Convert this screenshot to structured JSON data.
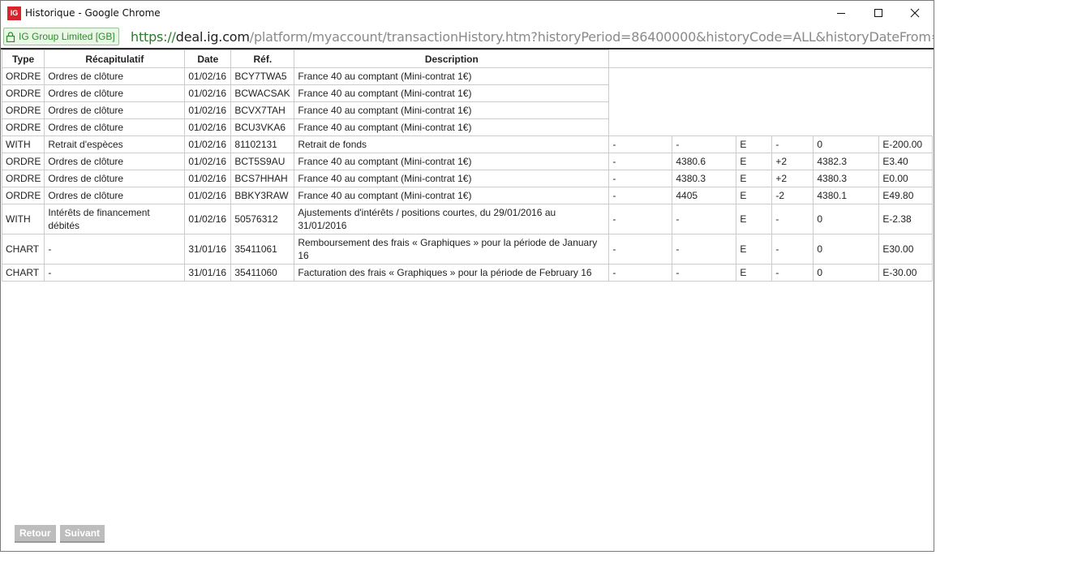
{
  "window": {
    "title": "Historique - Google Chrome",
    "app_icon_text": "IG",
    "controls": {
      "minimize": "—",
      "maximize": "☐",
      "close": "✕"
    }
  },
  "address": {
    "secure_label": "IG Group Limited [GB]",
    "url_scheme": "https://",
    "url_host": "deal.ig.com",
    "url_path": "/platform/myaccount/transactionHistory.htm?historyPeriod=86400000&historyCode=ALL&historyDateFrom=TODAY&hist"
  },
  "table": {
    "headers": [
      "Type",
      "Récapitulatif",
      "Date",
      "Réf.",
      "Description"
    ],
    "rows": [
      {
        "cells": [
          "ORDRE",
          "Ordres de clôture",
          "01/02/16",
          "BCY7TWA5",
          "France 40 au comptant (Mini-contrat 1€)"
        ],
        "extra": []
      },
      {
        "cells": [
          "ORDRE",
          "Ordres de clôture",
          "01/02/16",
          "BCWACSAK",
          "France 40 au comptant (Mini-contrat 1€)"
        ],
        "extra": []
      },
      {
        "cells": [
          "ORDRE",
          "Ordres de clôture",
          "01/02/16",
          "BCVX7TAH",
          "France 40 au comptant (Mini-contrat 1€)"
        ],
        "extra": []
      },
      {
        "cells": [
          "ORDRE",
          "Ordres de clôture",
          "01/02/16",
          "BCU3VKA6",
          "France 40 au comptant (Mini-contrat 1€)"
        ],
        "extra": []
      },
      {
        "cells": [
          "WITH",
          "Retrait d'espèces",
          "01/02/16",
          "81102131",
          "Retrait de fonds"
        ],
        "extra": [
          "-",
          "-",
          "E",
          "-",
          "0",
          "E-200.00"
        ]
      },
      {
        "cells": [
          "ORDRE",
          "Ordres de clôture",
          "01/02/16",
          "BCT5S9AU",
          "France 40 au comptant (Mini-contrat 1€)"
        ],
        "extra": [
          "-",
          "4380.6",
          "E",
          "+2",
          "4382.3",
          "E3.40"
        ]
      },
      {
        "cells": [
          "ORDRE",
          "Ordres de clôture",
          "01/02/16",
          "BCS7HHAH",
          "France 40 au comptant (Mini-contrat 1€)"
        ],
        "extra": [
          "-",
          "4380.3",
          "E",
          "+2",
          "4380.3",
          "E0.00"
        ]
      },
      {
        "cells": [
          "ORDRE",
          "Ordres de clôture",
          "01/02/16",
          "BBKY3RAW",
          "France 40 au comptant (Mini-contrat 1€)"
        ],
        "extra": [
          "-",
          "4405",
          "E",
          "-2",
          "4380.1",
          "E49.80"
        ]
      },
      {
        "cells": [
          "WITH",
          "Intérêts de financement débités",
          "01/02/16",
          "50576312",
          "Ajustements d'intérêts / positions courtes, du 29/01/2016 au 31/01/2016"
        ],
        "extra": [
          "-",
          "-",
          "E",
          "-",
          "0",
          "E-2.38"
        ]
      },
      {
        "cells": [
          "CHART",
          "-",
          "31/01/16",
          "35411061",
          "Remboursement des frais « Graphiques » pour la période de January 16"
        ],
        "extra": [
          "-",
          "-",
          "E",
          "-",
          "0",
          "E30.00"
        ]
      },
      {
        "cells": [
          "CHART",
          "-",
          "31/01/16",
          "35411060",
          "Facturation des frais « Graphiques » pour la période de February 16"
        ],
        "extra": [
          "-",
          "-",
          "E",
          "-",
          "0",
          "E-30.00"
        ]
      }
    ]
  },
  "footer": {
    "back_label": "Retour",
    "next_label": "Suivant"
  }
}
